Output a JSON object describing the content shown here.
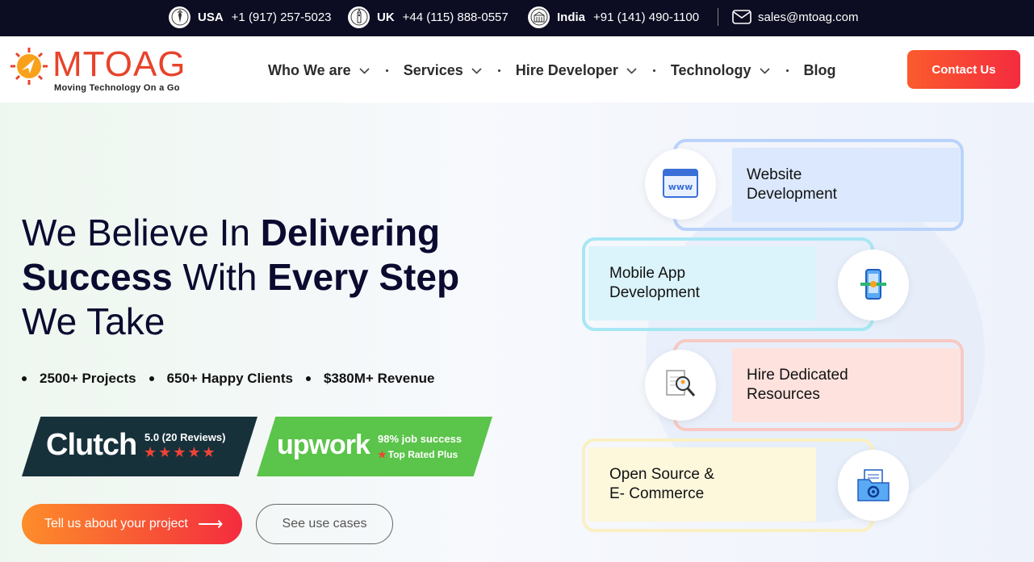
{
  "topbar": {
    "usa_label": "USA",
    "usa_phone": "+1 (917) 257-5023",
    "uk_label": "UK",
    "uk_phone": "+44 (115) 888-0557",
    "india_label": "India",
    "india_phone": "+91 (141) 490-1100",
    "email": "sales@mtoag.com"
  },
  "logo": {
    "text": "MTOAG",
    "tagline": "Moving Technology On a Go"
  },
  "nav": {
    "items": [
      {
        "label": "Who We are",
        "has_dropdown": true
      },
      {
        "label": "Services",
        "has_dropdown": true
      },
      {
        "label": "Hire Developer",
        "has_dropdown": true
      },
      {
        "label": "Technology",
        "has_dropdown": true
      },
      {
        "label": "Blog",
        "has_dropdown": false
      }
    ],
    "contact_label": "Contact Us"
  },
  "hero": {
    "headline_1": "We Believe In ",
    "headline_1_bold": "Delivering",
    "headline_2_bold": "Success",
    "headline_2": " With ",
    "headline_2b_bold": "Every Step",
    "headline_3": "We Take",
    "stats": [
      "2500+ Projects",
      "650+ Happy Clients",
      "$380M+ Revenue"
    ],
    "clutch": {
      "brand": "Clutch",
      "rating": "5.0 (20 Reviews)",
      "stars": "★★★★★"
    },
    "upwork": {
      "brand": "upwork",
      "success": "98% job success",
      "badge": "Top Rated Plus"
    },
    "cta_primary": "Tell us about your project",
    "cta_secondary": "See use cases"
  },
  "services": [
    {
      "line1": "Website",
      "line2": "Development",
      "icon": "www-browser-icon"
    },
    {
      "line1": "Mobile App",
      "line2": "Development",
      "icon": "mobile-app-icon"
    },
    {
      "line1": "Hire Dedicated",
      "line2": "Resources",
      "icon": "resource-search-icon"
    },
    {
      "line1": "Open Source &",
      "line2": "E- Commerce",
      "icon": "open-source-folder-icon"
    }
  ],
  "colors": {
    "topbar_bg": "#0c0c22",
    "accent": "#f42c3e",
    "accent_orange": "#fd8d2a",
    "headline": "#0b0b30",
    "clutch_bg": "#17313b",
    "upwork_bg": "#5bc44a"
  }
}
